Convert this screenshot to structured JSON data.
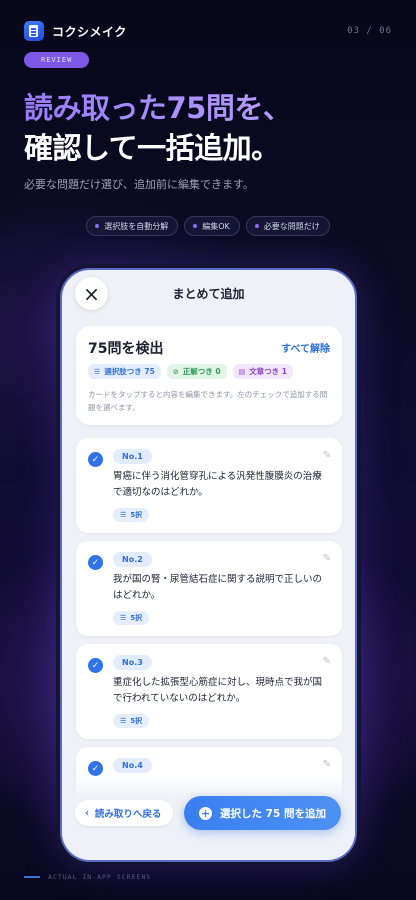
{
  "app": {
    "name": "コクシメイク",
    "pager": "03 / 06"
  },
  "badge": "REVIEW",
  "headline": {
    "line1": "読み取った75問を、",
    "line2": "確認して一括追加。"
  },
  "subcopy": "必要な問題だけ選び、追加前に編集できます。",
  "features": [
    "選択肢を自動分解",
    "編集OK",
    "必要な問題だけ"
  ],
  "screen": {
    "close_icon": "×",
    "title": "まとめて追加",
    "summary": {
      "count": "75問を検出",
      "clear_all": "すべて解除",
      "tags": [
        {
          "icon": "list-icon",
          "label": "選択肢つき 75"
        },
        {
          "icon": "check-circle-icon",
          "label": "正解つき 0"
        },
        {
          "icon": "document-icon",
          "label": "文章つき 1"
        }
      ],
      "hint": "カードをタップすると内容を編集できます。左のチェックで追加する問題を選べます。"
    },
    "questions": [
      {
        "no": "No.1",
        "text": "胃癌に伴う消化管穿孔による汎発性腹膜炎の治療で適切なのはどれか。",
        "choices": "5択",
        "checked": true
      },
      {
        "no": "No.2",
        "text": "我が国の腎・尿管結石症に関する説明で正しいのはどれか。",
        "choices": "5択",
        "checked": true
      },
      {
        "no": "No.3",
        "text": "重症化した拡張型心筋症に対し、現時点で我が国で行われていないのはどれか。",
        "choices": "5択",
        "checked": true
      },
      {
        "no": "No.4",
        "text": "",
        "choices": "",
        "checked": true
      }
    ],
    "back_button": "読み取りへ戻る",
    "add_button": "選択した 75 問を追加"
  },
  "footer": "ACTUAL IN-APP SCREENS",
  "colors": {
    "accent_purple": "#8a6cff",
    "accent_blue": "#2f73e6",
    "background": "#0b0b24"
  }
}
